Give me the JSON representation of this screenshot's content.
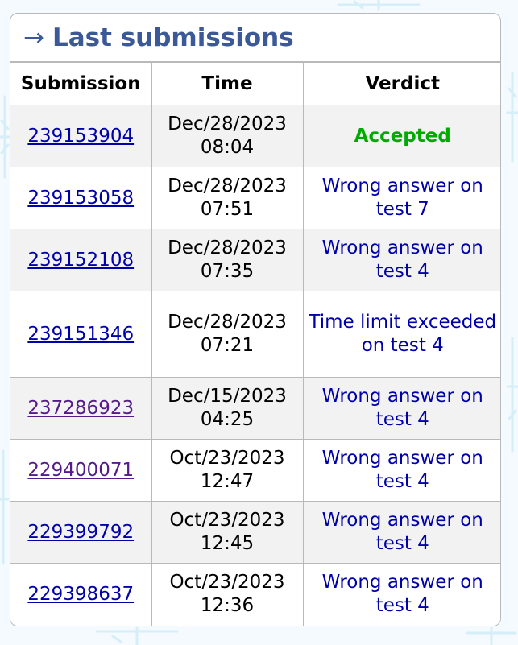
{
  "panel": {
    "arrow": "→",
    "title": "Last submissions"
  },
  "table": {
    "headers": [
      "Submission",
      "Time",
      "Verdict"
    ],
    "rows": [
      {
        "id": "239153904",
        "date": "Dec/28/2023",
        "time": "08:04",
        "verdict": "Accepted",
        "status": "accepted",
        "visited": false
      },
      {
        "id": "239153058",
        "date": "Dec/28/2023",
        "time": "07:51",
        "verdict": "Wrong answer on test 7",
        "status": "rejected",
        "visited": false
      },
      {
        "id": "239152108",
        "date": "Dec/28/2023",
        "time": "07:35",
        "verdict": "Wrong answer on test 4",
        "status": "rejected",
        "visited": false
      },
      {
        "id": "239151346",
        "date": "Dec/28/2023",
        "time": "07:21",
        "verdict": "Time limit exceeded on test 4",
        "status": "rejected",
        "visited": false
      },
      {
        "id": "237286923",
        "date": "Dec/15/2023",
        "time": "04:25",
        "verdict": "Wrong answer on test 4",
        "status": "rejected",
        "visited": true
      },
      {
        "id": "229400071",
        "date": "Oct/23/2023",
        "time": "12:47",
        "verdict": "Wrong answer on test 4",
        "status": "rejected",
        "visited": true
      },
      {
        "id": "229399792",
        "date": "Oct/23/2023",
        "time": "12:45",
        "verdict": "Wrong answer on test 4",
        "status": "rejected",
        "visited": false
      },
      {
        "id": "229398637",
        "date": "Oct/23/2023",
        "time": "12:36",
        "verdict": "Wrong answer on test 4",
        "status": "rejected",
        "visited": false
      }
    ]
  },
  "colors": {
    "title": "#3b5998",
    "accepted": "#00aa00",
    "rejected": "#0000aa",
    "link": "#0000aa",
    "link_visited": "#551a8b"
  }
}
